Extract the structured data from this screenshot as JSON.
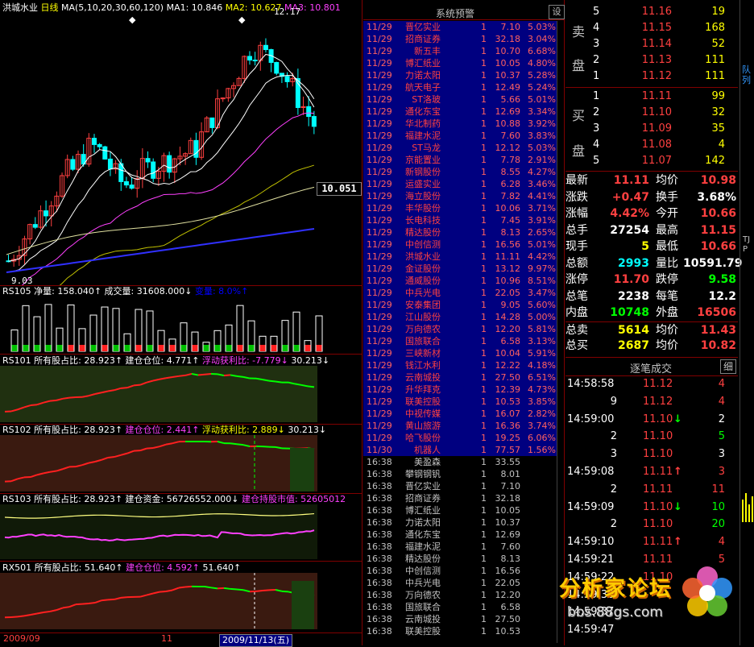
{
  "chart": {
    "stock_name": "洪城水业",
    "period": "日线",
    "ma_label": "MA(5,10,20,30,60,120)",
    "ma1": "MA1: 10.846",
    "ma2": "MA2: 10.627",
    "ma3": "MA3: 10.801",
    "high_label": "12.17",
    "low_label": "9.03",
    "price_tag": "10.051",
    "date_left": "2009/09",
    "date_mark": "11",
    "date_cursor": "2009/11/13(五)"
  },
  "panels": {
    "rs105": {
      "name": "RS105",
      "items": [
        "净量: 158.040↑",
        "成交量: 31608.000↓",
        "变量: 8.0%↑"
      ]
    },
    "rs101": {
      "name": "RS101",
      "items": [
        "所有股占比: 28.923↑",
        "建仓仓位: 4.771↑",
        "浮动获利比: -7.779↓",
        "30.213↓"
      ]
    },
    "rs102": {
      "name": "RS102",
      "items": [
        "所有股占比: 28.923↑",
        "建仓仓位: 2.441↑",
        "浮动获利比: 2.889↓",
        "30.213↓"
      ]
    },
    "rs103": {
      "name": "RS103",
      "items": [
        "所有股占比: 28.923↑",
        "建仓资金: 56726552.000↓",
        "建仓持股市值: 52605012"
      ]
    },
    "rx501": {
      "name": "RX501",
      "items": [
        "所有股占比: 51.640↑",
        "建仓仓位: 4.592↑",
        "51.640↑"
      ]
    }
  },
  "alerts": {
    "title": "系统预警",
    "settings_btn": "设",
    "rows": [
      {
        "d": "11/29",
        "n": "晋亿实业",
        "q": "1",
        "p": "7.10",
        "c": "5.03%"
      },
      {
        "d": "11/29",
        "n": "招商证券",
        "q": "1",
        "p": "32.18",
        "c": "3.04%"
      },
      {
        "d": "11/29",
        "n": "新五丰",
        "q": "1",
        "p": "10.70",
        "c": "6.68%"
      },
      {
        "d": "11/29",
        "n": "博汇纸业",
        "q": "1",
        "p": "10.05",
        "c": "4.80%"
      },
      {
        "d": "11/29",
        "n": "力诺太阳",
        "q": "1",
        "p": "10.37",
        "c": "5.28%"
      },
      {
        "d": "11/29",
        "n": "航天电子",
        "q": "1",
        "p": "12.49",
        "c": "5.24%"
      },
      {
        "d": "11/29",
        "n": "ST洛玻",
        "q": "1",
        "p": "5.66",
        "c": "5.01%"
      },
      {
        "d": "11/29",
        "n": "通化东宝",
        "q": "1",
        "p": "12.69",
        "c": "3.34%"
      },
      {
        "d": "11/29",
        "n": "华北制药",
        "q": "1",
        "p": "10.88",
        "c": "3.92%"
      },
      {
        "d": "11/29",
        "n": "福建水泥",
        "q": "1",
        "p": "7.60",
        "c": "3.83%"
      },
      {
        "d": "11/29",
        "n": "ST马龙",
        "q": "1",
        "p": "12.12",
        "c": "5.03%"
      },
      {
        "d": "11/29",
        "n": "京能置业",
        "q": "1",
        "p": "7.78",
        "c": "2.91%"
      },
      {
        "d": "11/29",
        "n": "新钢股份",
        "q": "1",
        "p": "8.55",
        "c": "4.27%"
      },
      {
        "d": "11/29",
        "n": "运盛实业",
        "q": "1",
        "p": "6.28",
        "c": "3.46%"
      },
      {
        "d": "11/29",
        "n": "海立股份",
        "q": "1",
        "p": "7.82",
        "c": "4.41%"
      },
      {
        "d": "11/29",
        "n": "丰华股份",
        "q": "1",
        "p": "10.06",
        "c": "3.71%"
      },
      {
        "d": "11/29",
        "n": "长电科技",
        "q": "1",
        "p": "7.45",
        "c": "3.91%"
      },
      {
        "d": "11/29",
        "n": "精达股份",
        "q": "1",
        "p": "8.13",
        "c": "2.65%"
      },
      {
        "d": "11/29",
        "n": "中创信测",
        "q": "1",
        "p": "16.56",
        "c": "5.01%"
      },
      {
        "d": "11/29",
        "n": "洪城水业",
        "q": "1",
        "p": "11.11",
        "c": "4.42%"
      },
      {
        "d": "11/29",
        "n": "金证股份",
        "q": "1",
        "p": "13.12",
        "c": "9.97%"
      },
      {
        "d": "11/29",
        "n": "通威股份",
        "q": "1",
        "p": "10.96",
        "c": "8.51%"
      },
      {
        "d": "11/29",
        "n": "中兵光电",
        "q": "1",
        "p": "22.05",
        "c": "3.47%"
      },
      {
        "d": "11/29",
        "n": "安泰集团",
        "q": "1",
        "p": "9.05",
        "c": "5.60%"
      },
      {
        "d": "11/29",
        "n": "江山股份",
        "q": "1",
        "p": "14.28",
        "c": "5.00%"
      },
      {
        "d": "11/29",
        "n": "万向德农",
        "q": "1",
        "p": "12.20",
        "c": "5.81%"
      },
      {
        "d": "11/29",
        "n": "国旅联合",
        "q": "1",
        "p": "6.58",
        "c": "3.13%"
      },
      {
        "d": "11/29",
        "n": "三峡新材",
        "q": "1",
        "p": "10.04",
        "c": "5.91%"
      },
      {
        "d": "11/29",
        "n": "钱江水利",
        "q": "1",
        "p": "12.22",
        "c": "4.18%"
      },
      {
        "d": "11/29",
        "n": "云南城投",
        "q": "1",
        "p": "27.50",
        "c": "6.51%"
      },
      {
        "d": "11/29",
        "n": "升华拜克",
        "q": "1",
        "p": "12.39",
        "c": "4.73%"
      },
      {
        "d": "11/29",
        "n": "联美控股",
        "q": "1",
        "p": "10.53",
        "c": "3.85%"
      },
      {
        "d": "11/29",
        "n": "中视传媒",
        "q": "1",
        "p": "16.07",
        "c": "2.82%"
      },
      {
        "d": "11/29",
        "n": "黄山旅游",
        "q": "1",
        "p": "16.36",
        "c": "3.74%"
      },
      {
        "d": "11/29",
        "n": "哈飞股份",
        "q": "1",
        "p": "19.25",
        "c": "6.06%"
      },
      {
        "d": "11/30",
        "n": "机器人",
        "q": "1",
        "p": "77.57",
        "c": "1.56%"
      }
    ],
    "plain_rows": [
      {
        "d": "16:38",
        "n": "美盈森",
        "q": "1",
        "p": "33.55"
      },
      {
        "d": "16:38",
        "n": "攀钢钢钒",
        "q": "1",
        "p": "8.01"
      },
      {
        "d": "16:38",
        "n": "晋亿实业",
        "q": "1",
        "p": "7.10"
      },
      {
        "d": "16:38",
        "n": "招商证券",
        "q": "1",
        "p": "32.18"
      },
      {
        "d": "16:38",
        "n": "博汇纸业",
        "q": "1",
        "p": "10.05"
      },
      {
        "d": "16:38",
        "n": "力诺太阳",
        "q": "1",
        "p": "10.37"
      },
      {
        "d": "16:38",
        "n": "通化东宝",
        "q": "1",
        "p": "12.69"
      },
      {
        "d": "16:38",
        "n": "福建水泥",
        "q": "1",
        "p": "7.60"
      },
      {
        "d": "16:38",
        "n": "精达股份",
        "q": "1",
        "p": "8.13"
      },
      {
        "d": "16:38",
        "n": "中创信测",
        "q": "1",
        "p": "16.56"
      },
      {
        "d": "16:38",
        "n": "中兵光电",
        "q": "1",
        "p": "22.05"
      },
      {
        "d": "16:38",
        "n": "万向德农",
        "q": "1",
        "p": "12.20"
      },
      {
        "d": "16:38",
        "n": "国旅联合",
        "q": "1",
        "p": "6.58"
      },
      {
        "d": "16:38",
        "n": "云南城投",
        "q": "1",
        "p": "27.50"
      },
      {
        "d": "16:38",
        "n": "联美控股",
        "q": "1",
        "p": "10.53"
      }
    ]
  },
  "orderbook": {
    "sell_label": [
      "卖",
      "盘"
    ],
    "buy_label": [
      "买",
      "盘"
    ],
    "sell": [
      {
        "lvl": "5",
        "price": "11.16",
        "vol": "19"
      },
      {
        "lvl": "4",
        "price": "11.15",
        "vol": "168"
      },
      {
        "lvl": "3",
        "price": "11.14",
        "vol": "52"
      },
      {
        "lvl": "2",
        "price": "11.13",
        "vol": "111"
      },
      {
        "lvl": "1",
        "price": "11.12",
        "vol": "111"
      }
    ],
    "buy": [
      {
        "lvl": "1",
        "price": "11.11",
        "vol": "99"
      },
      {
        "lvl": "2",
        "price": "11.10",
        "vol": "32"
      },
      {
        "lvl": "3",
        "price": "11.09",
        "vol": "35"
      },
      {
        "lvl": "4",
        "price": "11.08",
        "vol": "4"
      },
      {
        "lvl": "5",
        "price": "11.07",
        "vol": "142"
      }
    ]
  },
  "quote": [
    {
      "k1": "最新",
      "v1": "11.11",
      "c1": "red",
      "k2": "均价",
      "v2": "10.98",
      "c2": "red"
    },
    {
      "k1": "涨跌",
      "v1": "+0.47",
      "c1": "red",
      "k2": "换手",
      "v2": "3.68%",
      "c2": "white"
    },
    {
      "k1": "涨幅",
      "v1": "4.42%",
      "c1": "red",
      "k2": "今开",
      "v2": "10.66",
      "c2": "red"
    },
    {
      "k1": "总手",
      "v1": "27254",
      "c1": "white",
      "k2": "最高",
      "v2": "11.15",
      "c2": "red"
    },
    {
      "k1": "现手",
      "v1": "5",
      "c1": "yellow",
      "k2": "最低",
      "v2": "10.66",
      "c2": "red"
    },
    {
      "k1": "总额",
      "v1": "2993",
      "c1": "cyan",
      "k2": "量比",
      "v2": "10591.79",
      "c2": "white"
    },
    {
      "k1": "涨停",
      "v1": "11.70",
      "c1": "red",
      "k2": "跌停",
      "v2": "9.58",
      "c2": "green"
    },
    {
      "k1": "总笔",
      "v1": "2238",
      "c1": "white",
      "k2": "每笔",
      "v2": "12.2",
      "c2": "white"
    },
    {
      "k1": "内盘",
      "v1": "10748",
      "c1": "green",
      "k2": "外盘",
      "v2": "16506",
      "c2": "red"
    },
    {
      "k1": "总卖",
      "v1": "5614",
      "c1": "yellow",
      "k2": "均价",
      "v2": "11.43",
      "c2": "red"
    },
    {
      "k1": "总买",
      "v1": "2687",
      "c1": "yellow",
      "k2": "均价",
      "v2": "10.82",
      "c2": "red"
    }
  ],
  "ticks": {
    "title": "逐笔成交",
    "detail_btn": "细",
    "rows": [
      {
        "t": "14:58:58",
        "p": "11.12",
        "a": "",
        "v": "4",
        "vc": "red"
      },
      {
        "t": "9",
        "p": "11.12",
        "a": "",
        "v": "4",
        "vc": "red"
      },
      {
        "t": "14:59:00",
        "p": "11.10",
        "a": "↓",
        "v": "2",
        "vc": "white"
      },
      {
        "t": "2",
        "p": "11.10",
        "a": "",
        "v": "5",
        "vc": "green"
      },
      {
        "t": "3",
        "p": "11.10",
        "a": "",
        "v": "3",
        "vc": "white"
      },
      {
        "t": "14:59:08",
        "p": "11.11",
        "a": "↑",
        "v": "3",
        "vc": "red"
      },
      {
        "t": "2",
        "p": "11.11",
        "a": "",
        "v": "11",
        "vc": "red"
      },
      {
        "t": "14:59:09",
        "p": "11.10",
        "a": "↓",
        "v": "10",
        "vc": "green"
      },
      {
        "t": "2",
        "p": "11.10",
        "a": "",
        "v": "20",
        "vc": "green"
      },
      {
        "t": "14:59:10",
        "p": "11.11",
        "a": "↑",
        "v": "4",
        "vc": "red"
      },
      {
        "t": "14:59:21",
        "p": "11.11",
        "a": "",
        "v": "5",
        "vc": "red"
      },
      {
        "t": "14:59:22",
        "p": "11.10",
        "a": "",
        "v": "",
        "vc": "white"
      },
      {
        "t": "14:59:30",
        "p": "",
        "a": "",
        "v": "",
        "vc": "white"
      },
      {
        "t": "14:59:37",
        "p": "",
        "a": "",
        "v": "",
        "vc": "white"
      },
      {
        "t": "14:59:47",
        "p": "",
        "a": "",
        "v": "",
        "vc": "white"
      }
    ]
  },
  "right_strip": {
    "top": "队列",
    "bottom": "TJP"
  },
  "watermark": {
    "title": "分析家论坛",
    "url": "bbs.88gs.com"
  },
  "colors": {
    "up": "#ff4040",
    "down": "#00ff00",
    "alert_bg": "#000080",
    "border": "#800000"
  }
}
